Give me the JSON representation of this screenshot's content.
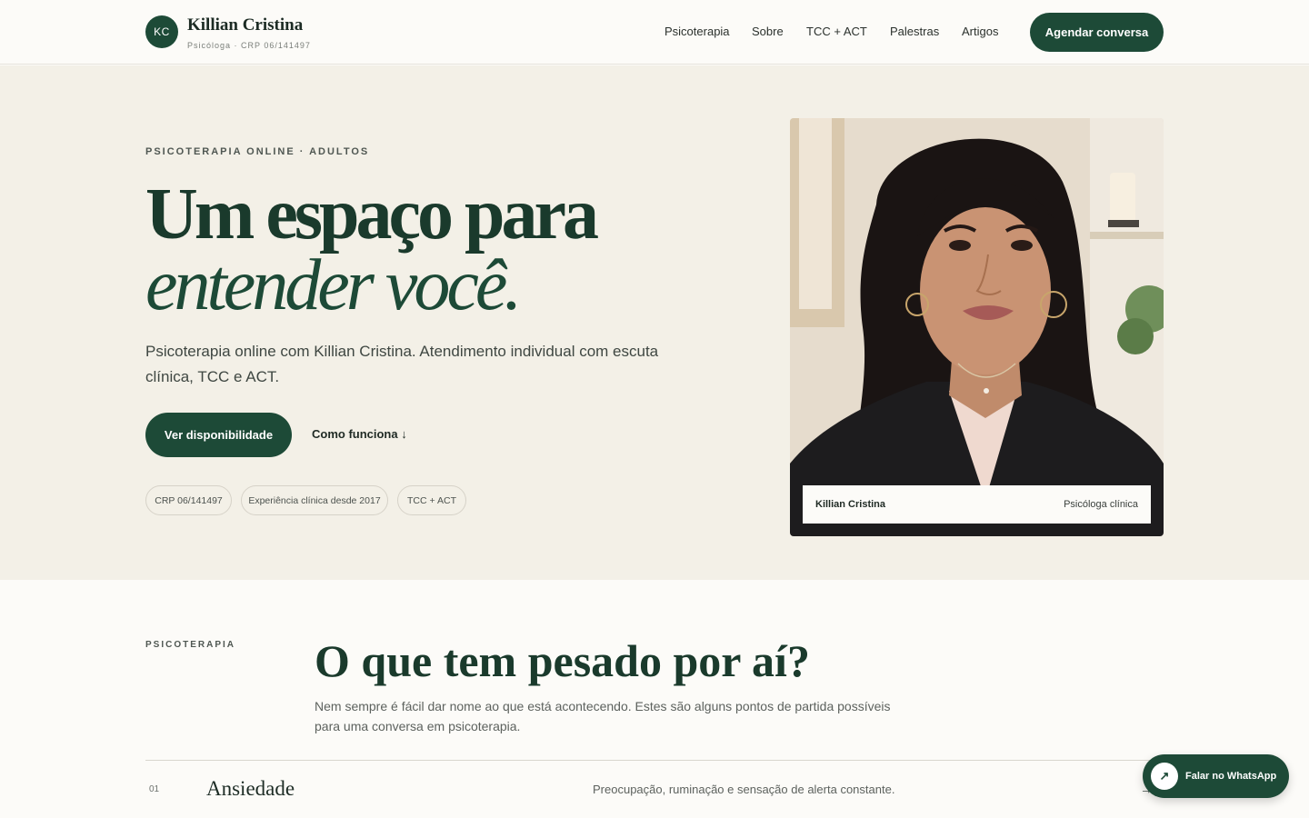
{
  "header": {
    "logo_initials": "KC",
    "brand_name": "Killian Cristina",
    "brand_subtitle": "Psicóloga · CRP 06/141497",
    "nav": [
      "Psicoterapia",
      "Sobre",
      "TCC + ACT",
      "Palestras",
      "Artigos"
    ],
    "cta_label": "Agendar conversa"
  },
  "hero": {
    "eyebrow": "PSICOTERAPIA ONLINE · ADULTOS",
    "title_line1": "Um espaço para",
    "title_line2": "entender você.",
    "lead": "Psicoterapia online com Killian Cristina. Atendimento individual com escuta clínica, TCC e ACT.",
    "primary_button": "Ver disponibilidade",
    "secondary_link": "Como funciona ↓",
    "chips": [
      "CRP 06/141497",
      "Experiência clínica desde 2017",
      "TCC + ACT"
    ],
    "portrait_caption_name": "Killian Cristina",
    "portrait_caption_role": "Psicóloga clínica"
  },
  "section": {
    "eyebrow": "PSICOTERAPIA",
    "title": "O que tem pesado por aí?",
    "description": "Nem sempre é fácil dar nome ao que está acontecendo. Estes são alguns pontos de partida possíveis para uma conversa em psicoterapia.",
    "items": [
      {
        "number": "01",
        "title": "Ansiedade",
        "description": "Preocupação, ruminação e sensação de alerta constante.",
        "arrow": "→"
      }
    ]
  },
  "whatsapp": {
    "label": "Falar no WhatsApp",
    "icon": "↗"
  },
  "colors": {
    "accent": "#1d4a37",
    "hero_bg": "#f3f0e7",
    "page_bg": "#fcfbf8"
  }
}
